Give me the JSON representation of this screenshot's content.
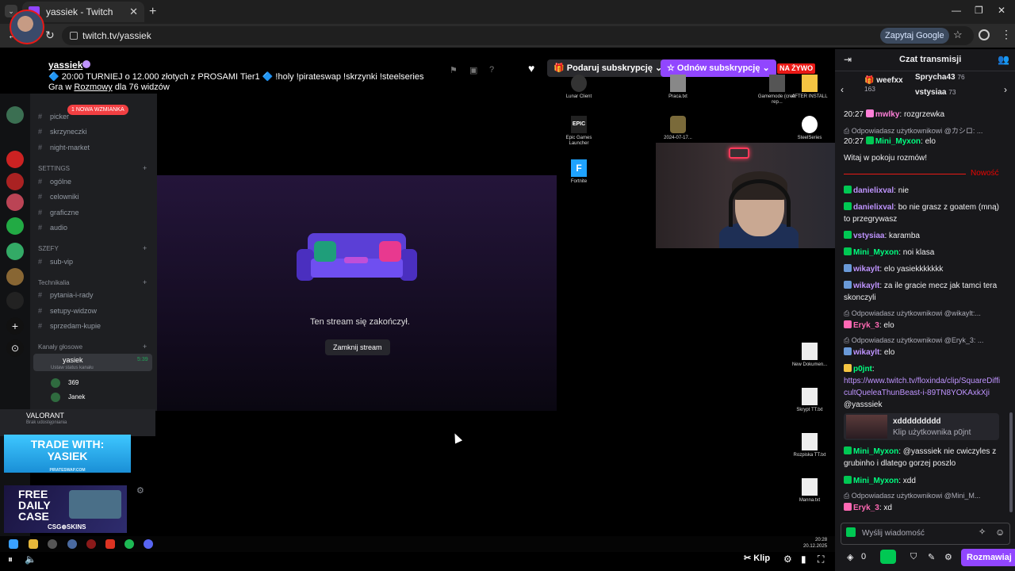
{
  "browser": {
    "tab_title": "yassiek - Twitch",
    "url": "twitch.tv/yassiek",
    "google_button": "Zapytaj Google"
  },
  "stream": {
    "channel": "yassiek",
    "title": "🔷 20:00 TURNIEJ o 12.000 złotych z PROSAMI Tier1 🔷 !holy !pirateswap !skrzynki !steelseries",
    "game_prefix": "Gra w",
    "game": "Rozmowy",
    "viewers": "dla 76 widzów",
    "gift_label": "Podaruj subskrypcję",
    "resub_label": "Odnów subskrypcję",
    "live_label": "NA ŻYWO",
    "ended_text": "Ten stream się zakończył.",
    "close_label": "Zamknij stream",
    "clip_label": "Klip"
  },
  "discord": {
    "new_mention": "1 NOWA WZMIANKA",
    "channels_top": [
      "picker",
      "skrzyneczki",
      "night-market"
    ],
    "settings_category": "SETTINGS",
    "settings_channels": [
      "ogólne",
      "celowniki",
      "graficzne",
      "audio"
    ],
    "szefy_category": "SZEFY",
    "szefy_channels": [
      "sub-vip"
    ],
    "tech_category": "Technikalia",
    "tech_channels": [
      "pytania-i-rady",
      "setupy-widzow",
      "sprzedam-kupie"
    ],
    "voice_category": "Kanały głosowe",
    "voice_channel": "yasiek",
    "voice_status": "Ustaw status kanału",
    "voice_time": "5:39",
    "voice_users": [
      "369",
      "Janek"
    ],
    "activity_title": "VALORANT",
    "activity_sub": "Brak udostępniania",
    "ad1_line1": "TRADE WITH:",
    "ad1_line2": "YASIEK",
    "ad1_site": "PIRATESWAP.COM",
    "ad2_line": "FREE DAILY CASE",
    "ad2_brand": "CSG⊕SKINS"
  },
  "desktop": {
    "icons": [
      {
        "name": "Lunar Client"
      },
      {
        "name": "Praca.txt"
      },
      {
        "name": "Gamemode (cred. rep..."
      },
      {
        "name": "AFTER INSTALL"
      },
      {
        "name": "Epic Games Launcher"
      },
      {
        "name": "2024-07-17..."
      },
      {
        "name": "SteelSeries"
      },
      {
        "name": "Fortnite"
      },
      {
        "name": "New Dokumen..."
      },
      {
        "name": "Skrypt TT.txt"
      },
      {
        "name": "Rozpiska TT.txt"
      },
      {
        "name": "Manna.txt"
      }
    ],
    "time": "20:28",
    "date": "20.12.2025"
  },
  "chat": {
    "header": "Czat transmisji",
    "gifters": [
      {
        "name": "weefxx",
        "count": "163"
      },
      {
        "name": "Sprycha43",
        "count": "76"
      },
      {
        "name": "vstysiaa",
        "count": "73"
      }
    ],
    "welcome": "Witaj w pokoju rozmów!",
    "new_label": "Nowość",
    "messages": [
      {
        "time": "20:27",
        "user": "mwlky",
        "text": "rozgrzewka",
        "color": "#ff7fd8"
      },
      {
        "reply": "Odpowiadasz użytkownikowi @カシロ: ..."
      },
      {
        "time": "20:27",
        "user": "Mini_Myxon",
        "text": "elo",
        "color": "#00ff7f"
      },
      {
        "user": "danielixval",
        "text": "nie",
        "color": "#bf94ff"
      },
      {
        "user": "danielixval",
        "text": "bo nie grasz z goatem (mną) to przegrywasz",
        "color": "#bf94ff"
      },
      {
        "user": "vstysiaa",
        "text": "karamba",
        "color": "#bf94ff"
      },
      {
        "user": "Mini_Myxon",
        "text": "noi klasa",
        "color": "#00ff7f"
      },
      {
        "user": "wikaylt",
        "text": "elo yasiekkkkkkk",
        "color": "#bf94ff"
      },
      {
        "user": "wikaylt",
        "text": "za ile gracie mecz jak tamci tera skonczyli",
        "color": "#bf94ff"
      },
      {
        "reply": "Odpowiadasz użytkownikowi @wikaylt:..."
      },
      {
        "user": "Eryk_3",
        "text": "elo",
        "color": "#ff69b4"
      },
      {
        "reply": "Odpowiadasz użytkownikowi @Eryk_3: ..."
      },
      {
        "user": "wikaylt",
        "text": "elo",
        "color": "#bf94ff"
      },
      {
        "user": "p0jnt",
        "text": "",
        "color": "#00ff7f"
      },
      {
        "link": "https://www.twitch.tv/floxinda/clip/SquareDifficultQueleaThunBeast-i-89TN8YOKAxkXji",
        "after": "@yasssiek"
      },
      {
        "user": "Mini_Myxon",
        "text": "@yasssiek nie cwiczyles z grubinho i dlatego gorzej poszlo",
        "color": "#00ff7f"
      },
      {
        "user": "Mini_Myxon",
        "text": "xdd",
        "color": "#00ff7f"
      },
      {
        "reply": "Odpowiadasz użytkownikowi @Mini_M..."
      },
      {
        "user": "Eryk_3",
        "text": "xd",
        "color": "#ff69b4"
      }
    ],
    "clip_title": "xddddddddd",
    "clip_sub": "Klip użytkownika p0jnt",
    "input_placeholder": "Wyślij wiadomość",
    "points": "0",
    "send_label": "Rozmawiaj"
  }
}
